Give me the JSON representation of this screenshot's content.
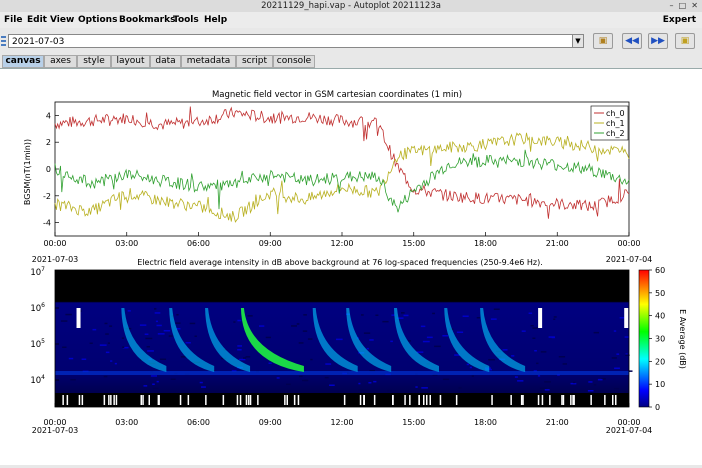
{
  "window": {
    "title": "20211129_hapi.vap - Autoplot 20211123a"
  },
  "menu": {
    "items": [
      "File",
      "Edit",
      "View",
      "Options",
      "Bookmarks",
      "Tools",
      "Help"
    ],
    "expert": "Expert"
  },
  "url_bar": {
    "value": "2021-07-03"
  },
  "tabs": [
    "canvas",
    "axes",
    "style",
    "layout",
    "data",
    "metadata",
    "script",
    "console"
  ],
  "active_tab": "canvas",
  "colors": {
    "ch0": "#c03030",
    "ch1": "#b8b020",
    "ch2": "#30a030",
    "active_tab": "#b8d0e8"
  },
  "icons": [
    "url-list-icon",
    "dropdown-arrow-icon",
    "bookmark-icon",
    "back-icon",
    "forward-icon",
    "folder-icon"
  ],
  "chart_data": [
    {
      "type": "line",
      "title": "Magnetic field vector in GSM cartesian coordinates (1 min)",
      "ylabel": "BGSM(nT(1min))",
      "ylim": [
        -5,
        5
      ],
      "yticks": [
        "4",
        "2",
        "0",
        "-2",
        "-4"
      ],
      "xticks": [
        "00:00",
        "03:00",
        "06:00",
        "09:00",
        "12:00",
        "15:00",
        "18:00",
        "21:00",
        "00:00"
      ],
      "x_date_start": "2021-07-03",
      "x_date_end": "2021-07-04",
      "x_hours": [
        0,
        1.5,
        3,
        4.5,
        6,
        7.5,
        9,
        10.5,
        12,
        13.5,
        14.3,
        15,
        16.5,
        18,
        19.5,
        21,
        22.5,
        24
      ],
      "series": [
        {
          "name": "ch_0",
          "values": [
            3.4,
            3.6,
            3.8,
            3.3,
            3.5,
            4.2,
            3.8,
            3.9,
            3.6,
            3.4,
            0.2,
            -1.5,
            -2.0,
            -2.2,
            -2.3,
            -2.6,
            -2.8,
            -1.8
          ]
        },
        {
          "name": "ch_1",
          "values": [
            -2.6,
            -3.2,
            -1.8,
            -2.4,
            -2.8,
            -3.6,
            -1.8,
            -2.3,
            -1.4,
            -1.8,
            1.0,
            1.3,
            1.6,
            1.8,
            2.3,
            2.0,
            1.6,
            1.2
          ]
        },
        {
          "name": "ch_2",
          "values": [
            0.0,
            -1.1,
            -0.4,
            -0.9,
            -1.3,
            -1.2,
            -0.4,
            -0.9,
            -0.6,
            -0.6,
            -3.0,
            -1.6,
            0.4,
            0.6,
            0.6,
            0.3,
            -0.1,
            -1.0
          ]
        }
      ]
    },
    {
      "type": "heatmap",
      "title": "Electric field average intensity in dB above background at 76 log-spaced frequencies (250-9.4e6 Hz).",
      "yticks": [
        "10^7",
        "10^6",
        "10^5",
        "10^4"
      ],
      "xticks": [
        "00:00",
        "03:00",
        "06:00",
        "09:00",
        "12:00",
        "15:00",
        "18:00",
        "21:00",
        "00:00"
      ],
      "x_date_start": "2021-07-03",
      "x_date_end": "2021-07-04",
      "colorbar_label": "E Average (dB)",
      "colorbar_ticks": [
        "60",
        "50",
        "40",
        "30",
        "20",
        "10",
        "0"
      ],
      "zlim": [
        0,
        60
      ],
      "bursts_hours": [
        2.9,
        4.9,
        6.4,
        7.9,
        10.9,
        12.3,
        14.3,
        16.4,
        17.9
      ]
    }
  ]
}
